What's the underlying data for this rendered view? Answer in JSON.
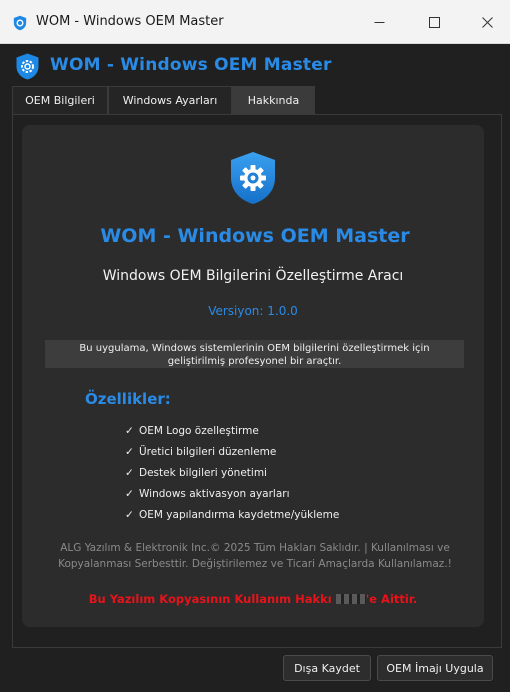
{
  "window": {
    "title": "WOM - Windows OEM Master"
  },
  "header": {
    "app_title": "WOM - Windows OEM Master"
  },
  "tabs": [
    {
      "label": "OEM Bilgileri"
    },
    {
      "label": "Windows Ayarları"
    },
    {
      "label": "Hakkında",
      "active": true
    }
  ],
  "about": {
    "title": "WOM - Windows OEM Master",
    "subtitle": "Windows OEM Bilgilerini Özelleştirme Aracı",
    "version": "Versiyon: 1.0.0",
    "description_line1": "Bu uygulama, Windows sistemlerinin OEM bilgilerini özelleştirmek için",
    "description_line2": "geliştirilmiş profesyonel bir araçtır.",
    "features_title": "Özellikler:",
    "check_glyph": "✓",
    "features": [
      "OEM Logo özelleştirme",
      "Üretici bilgileri düzenleme",
      "Destek bilgileri yönetimi",
      "Windows aktivasyon ayarları",
      "OEM yapılandırma kaydetme/yükleme"
    ],
    "copyright_line1": "ALG Yazılım & Elektronik Inc.© 2025 Tüm Hakları Saklıdır. | Kullanılması ve",
    "copyright_line2": "Kopyalanması Serbesttir. Değiştirilemez ve Ticari Amaçlarda Kullanılamaz.!",
    "rights_before": "Bu Yazılım Kopyasının Kullanım Hakkı ",
    "rights_after": "'e Aittir."
  },
  "buttons": {
    "export": "Dışa Kaydet",
    "apply": "OEM İmajı Uygula"
  },
  "colors": {
    "accent": "#2a8be6",
    "warning": "#e8131a",
    "background": "#202020",
    "card": "#2c2c2c"
  },
  "icons": [
    "shield-gear-icon",
    "minimize-icon",
    "maximize-icon",
    "close-icon",
    "check-icon"
  ]
}
